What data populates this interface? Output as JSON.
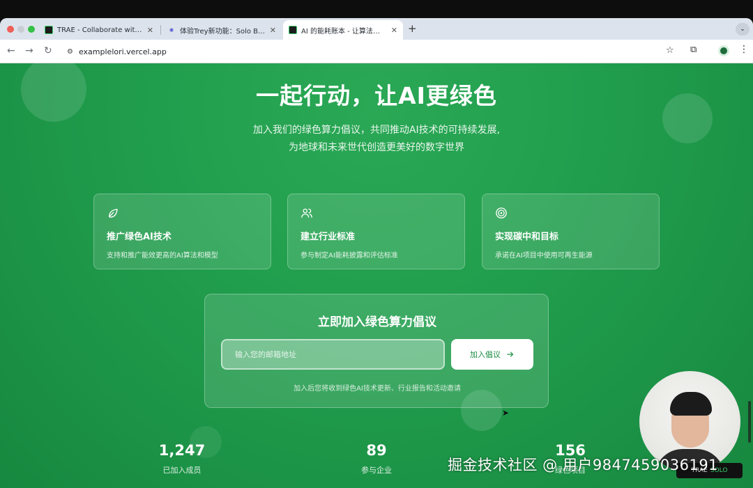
{
  "browser": {
    "tabs": [
      {
        "title": "TRAE - Collaborate with intelligence",
        "active": false
      },
      {
        "title": "体验Trey新功能：Solo Builder",
        "active": false
      },
      {
        "title": "AI 的能耗账本 - 让算法更高效",
        "active": true
      }
    ],
    "url": "examplelori.vercel.app"
  },
  "hero": {
    "title": "一起行动，让AI更绿色",
    "subtitle_line1": "加入我们的绿色算力倡议，共同推动AI技术的可持续发展,",
    "subtitle_line2": "为地球和未来世代创造更美好的数字世界"
  },
  "cards": [
    {
      "icon": "leaf-icon",
      "title": "推广绿色AI技术",
      "desc": "支持和推广能效更高的AI算法和模型"
    },
    {
      "icon": "users-icon",
      "title": "建立行业标准",
      "desc": "参与制定AI能耗披露和评估标准"
    },
    {
      "icon": "target-icon",
      "title": "实现碳中和目标",
      "desc": "承诺在AI项目中使用可再生能源"
    }
  ],
  "signup": {
    "title": "立即加入绿色算力倡议",
    "email_placeholder": "输入您的邮箱地址",
    "button_label": "加入倡议",
    "note": "加入后您将收到绿色AI技术更新、行业报告和活动邀请"
  },
  "stats": [
    {
      "value": "1,247",
      "label": "已加入成员"
    },
    {
      "value": "89",
      "label": "参与企业"
    },
    {
      "value": "156",
      "label": "绿色项目"
    }
  ],
  "overlay": {
    "watermark": "掘金技术社区 @ 用户9847459036191",
    "badge_brand": "TRAE",
    "badge_tag": "SOLO"
  },
  "colors": {
    "page_green": "#22a04e",
    "button_text": "#1a8d43"
  }
}
